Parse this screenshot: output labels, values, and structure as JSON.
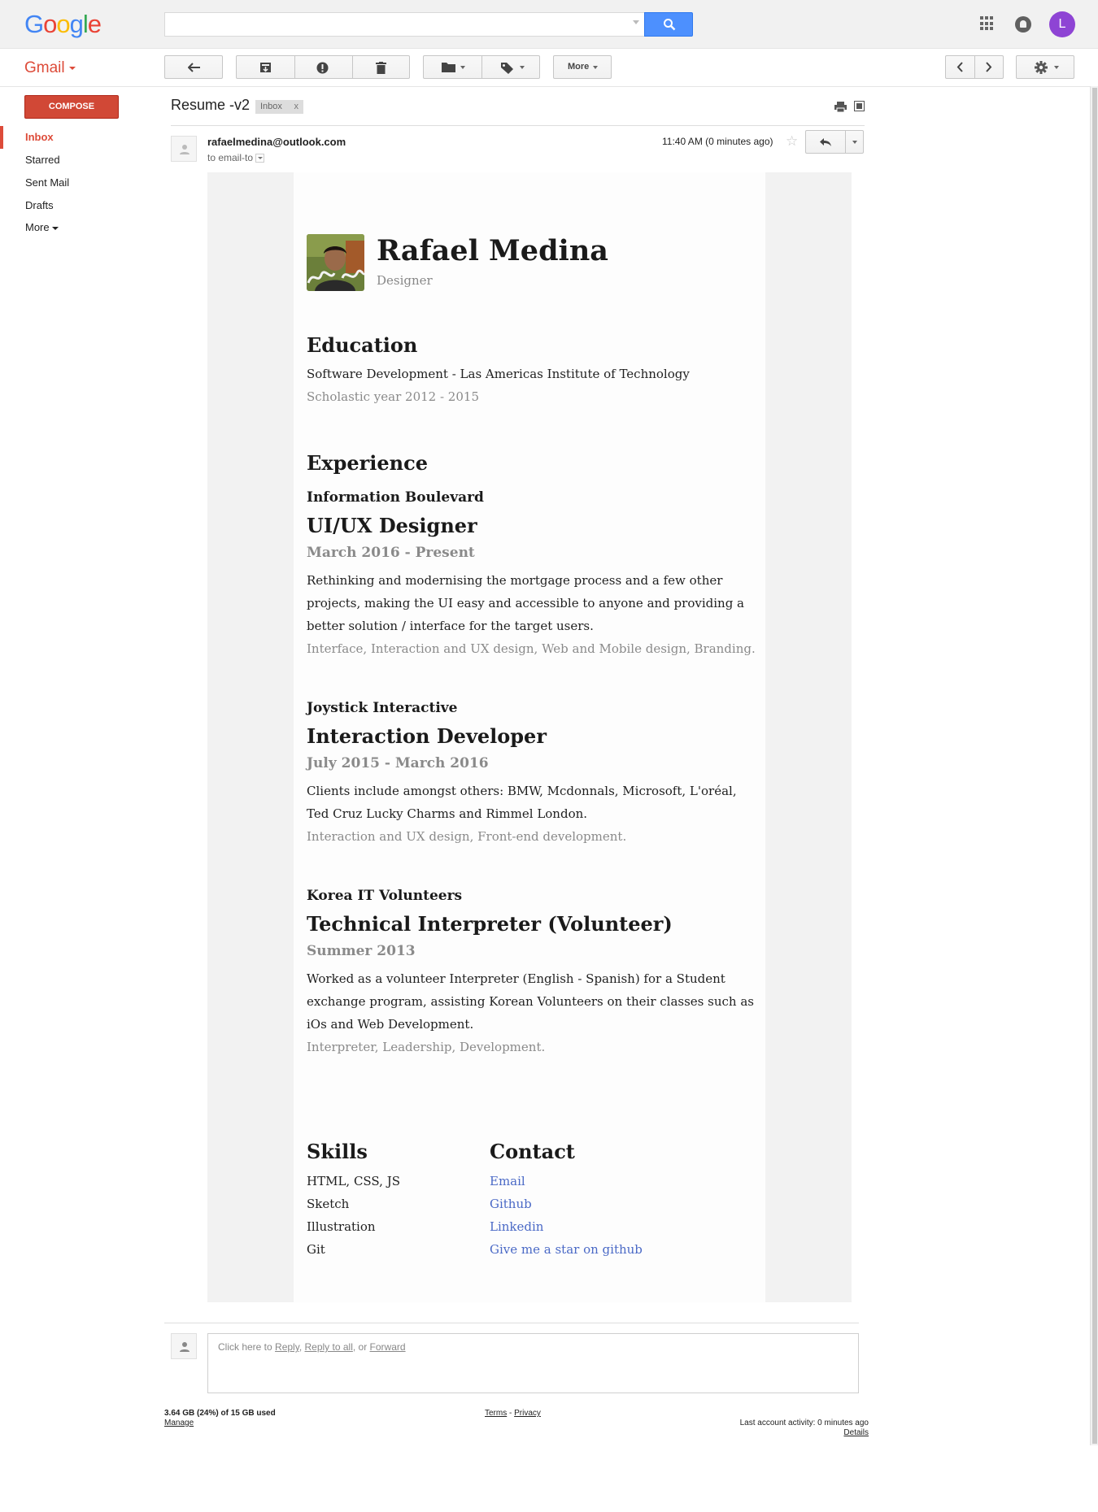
{
  "google_logo": {
    "letters": [
      "G",
      "o",
      "o",
      "g",
      "l",
      "e"
    ],
    "colors": [
      "#4285f4",
      "#ea4335",
      "#fbbc05",
      "#4285f4",
      "#34a853",
      "#ea4335"
    ]
  },
  "search": {
    "placeholder": ""
  },
  "account": {
    "initial": "L",
    "color": "#8e44d4"
  },
  "app": {
    "name": "Gmail",
    "accent": "#dd4b39"
  },
  "toolbar": {
    "more_label": "More"
  },
  "sidebar": {
    "compose_label": "COMPOSE",
    "items": [
      {
        "label": "Inbox",
        "active": true
      },
      {
        "label": "Starred"
      },
      {
        "label": "Sent Mail"
      },
      {
        "label": "Drafts"
      },
      {
        "label": "More"
      }
    ]
  },
  "message": {
    "subject": "Resume -v2",
    "label_badge": "Inbox",
    "label_remove": "x",
    "sender": "rafaelmedina@outlook.com",
    "to_line": "to email-to",
    "time": "11:40 AM (0 minutes ago)"
  },
  "resume": {
    "name": "Rafael Medina",
    "role": "Designer",
    "education": {
      "heading": "Education",
      "degree": "Software Development - Las Americas Institute of Technology",
      "period": "Scholastic year 2012 - 2015"
    },
    "experience": {
      "heading": "Experience",
      "jobs": [
        {
          "company": "Information Boulevard",
          "title": "UI/UX Designer",
          "period": "March 2016 - Present",
          "description": "Rethinking and modernising the mortgage process and a few other projects, making the UI easy and accessible to anyone and providing a better solution / interface for the target users.",
          "skills": "Interface, Interaction and UX design, Web and Mobile design, Branding."
        },
        {
          "company": "Joystick Interactive",
          "title": "Interaction Developer",
          "period": "July 2015 - March 2016",
          "description": "Clients include amongst others: BMW, Mcdonnals, Microsoft, L'oréal, Ted Cruz Lucky Charms and Rimmel London.",
          "skills": "Interaction and UX design, Front-end development."
        },
        {
          "company": "Korea IT Volunteers",
          "title": "Technical Interpreter (Volunteer)",
          "period": "Summer 2013",
          "description": "Worked as a volunteer Interpreter (English - Spanish) for a Student exchange program, assisting Korean Volunteers on their classes such as iOs and Web Development.",
          "skills": "Interpreter, Leadership, Development."
        }
      ]
    },
    "skills": {
      "heading": "Skills",
      "items": [
        "HTML, CSS, JS",
        "Sketch",
        "Illustration",
        "Git"
      ]
    },
    "contact": {
      "heading": "Contact",
      "links": [
        "Email",
        "Github",
        "Linkedin",
        "Give me a star on github"
      ],
      "link_color": "#4a69c6"
    }
  },
  "reply": {
    "prefix": "Click here to ",
    "reply": "Reply",
    "sep1": ", ",
    "reply_all": "Reply to all",
    "sep2": ", or ",
    "forward": "Forward"
  },
  "footer": {
    "storage": "3.64 GB (24%) of 15 GB used",
    "manage": "Manage",
    "terms": "Terms",
    "dash": " - ",
    "privacy": "Privacy",
    "activity": "Last account activity: 0 minutes ago",
    "details": "Details"
  }
}
